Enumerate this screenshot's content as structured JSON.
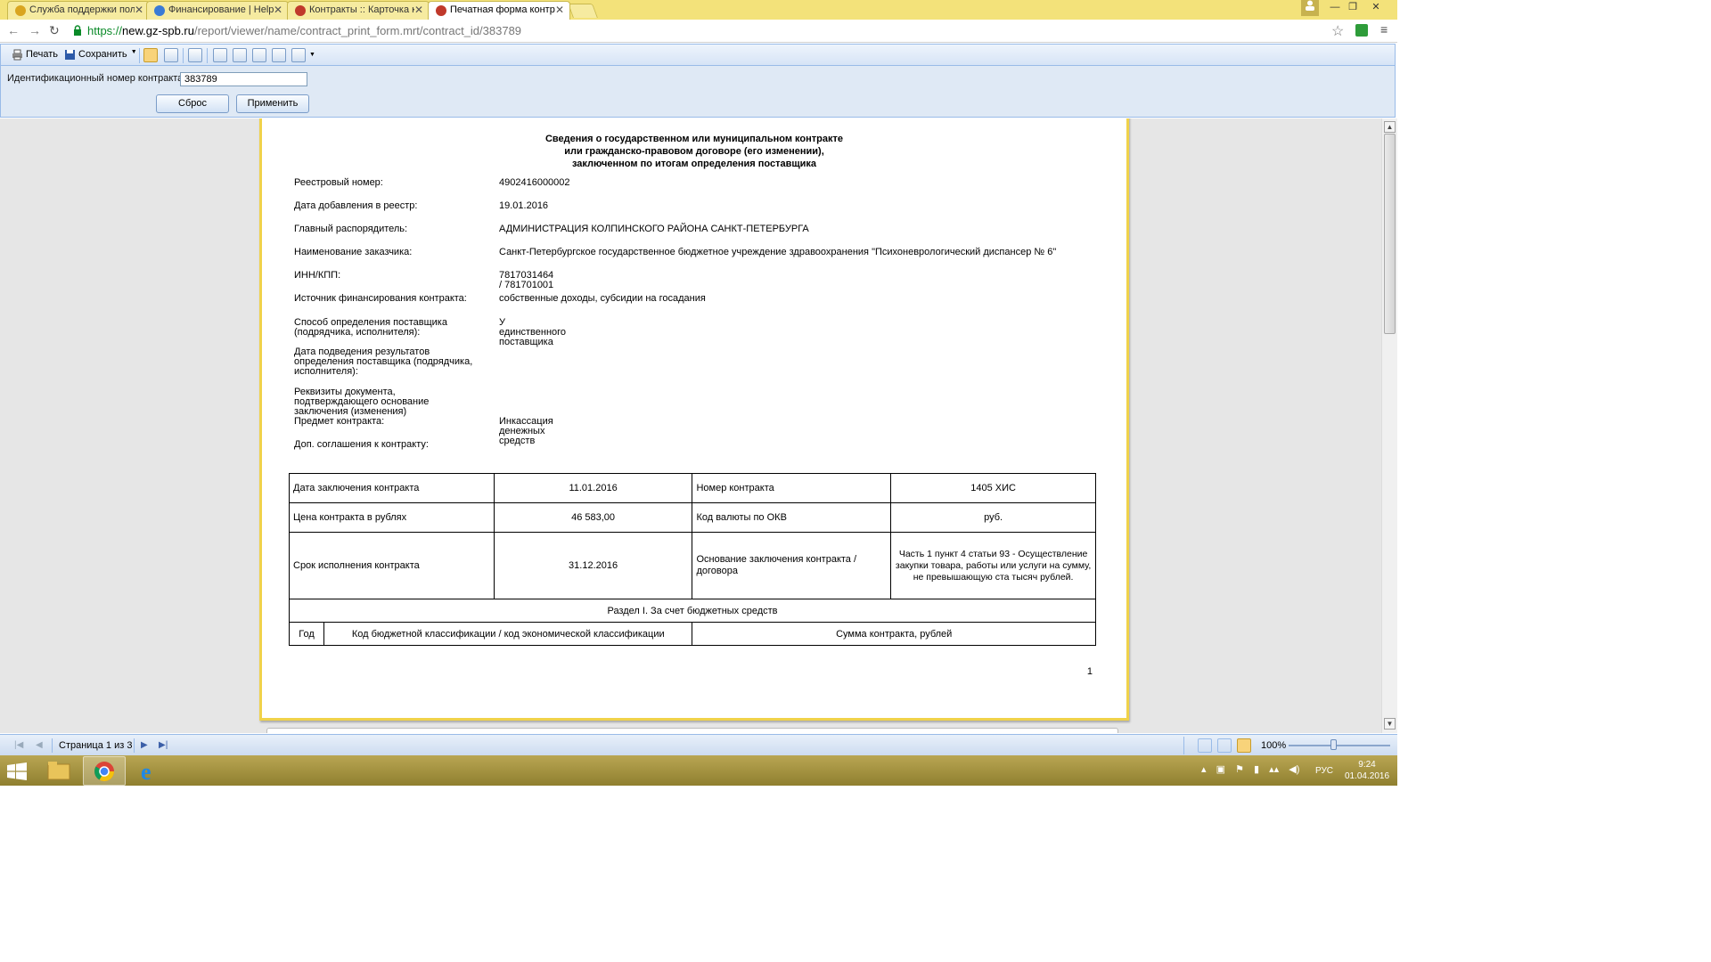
{
  "browser": {
    "tabs": [
      {
        "title": "Служба поддержки поль",
        "favicon_color": "#d9a520"
      },
      {
        "title": "Финансирование | HelpD",
        "favicon_color": "#3a7bd5"
      },
      {
        "title": "Контракты :: Карточка ко",
        "favicon_color": "#c0392b"
      },
      {
        "title": "Печатная форма контра",
        "favicon_color": "#c0392b"
      }
    ],
    "close_glyph": "✕",
    "url_scheme": "https://",
    "url_host": "new.gz-spb.ru",
    "url_path": "/report/viewer/name/contract_print_form.mrt/contract_id/383789"
  },
  "toolbar": {
    "print_label": "Печать",
    "save_label": "Сохранить"
  },
  "params": {
    "contract_id_label": "Идентификационный номер контракта",
    "contract_id_value": "383789",
    "reset_label": "Сброс",
    "apply_label": "Применить"
  },
  "report": {
    "title_line1": "Сведения о государственном или муниципальном контракте",
    "title_line2": "или гражданско-правовом договоре (его изменении),",
    "title_line3": "заключенном по итогам определения поставщика",
    "fields": [
      {
        "label": "Реестровый номер:",
        "value": "4902416000002"
      },
      {
        "label": "Дата добавления в реестр:",
        "value": "19.01.2016"
      },
      {
        "label": "Главный распорядитель:",
        "value": "АДМИНИСТРАЦИЯ КОЛПИНСКОГО РАЙОНА САНКТ-ПЕТЕРБУРГА"
      },
      {
        "label": "Наименование заказчика:",
        "value": "Санкт-Петербургское государственное бюджетное учреждение здравоохранения \"Психоневрологический диспансер № 6\""
      },
      {
        "label": "ИНН/КПП:",
        "value": "7817031464 / 781701001"
      },
      {
        "label": "Источник финансирования контракта:",
        "value": "собственные доходы, субсидии на госадания"
      },
      {
        "label": "Способ определения поставщика (подрядчика, исполнителя):",
        "value": "У единственного поставщика"
      },
      {
        "label": "Дата подведения результатов определения поставщика (подрядчика, исполнителя):",
        "value": ""
      },
      {
        "label": "Реквизиты документа, подтверждающего основание заключения (изменения)",
        "value": ""
      },
      {
        "label": "Предмет контракта:",
        "value": "Инкассация денежных средств"
      },
      {
        "label": "Доп. соглашения к контракту:",
        "value": ""
      }
    ],
    "table": {
      "r1": {
        "l1": "Дата заключения контракта",
        "v1": "11.01.2016",
        "l2": "Номер контракта",
        "v2": "1405 ХИС"
      },
      "r2": {
        "l1": "Цена контракта в рублях",
        "v1": "46 583,00",
        "l2": "Код валюты по ОКВ",
        "v2": "руб."
      },
      "r3": {
        "l1": "Срок исполнения контракта",
        "v1": "31.12.2016",
        "l2": "Основание заключения контракта / договора",
        "v2": "Часть 1 пункт 4 статьи 93 - Осуществление закупки товара, работы или услуги на сумму, не превышающую ста тысяч рублей."
      },
      "section": "Раздел I. За счет бюджетных средств",
      "h_year": "Год",
      "h_code": "Код бюджетной классификации / код экономической классификации",
      "h_sum": "Сумма контракта, рублей"
    },
    "page_number": "1"
  },
  "statusbar": {
    "page_info": "Страница 1 из 3",
    "zoom": "100%"
  },
  "taskbar": {
    "language": "РУС",
    "time": "9:24",
    "date": "01.04.2016"
  }
}
